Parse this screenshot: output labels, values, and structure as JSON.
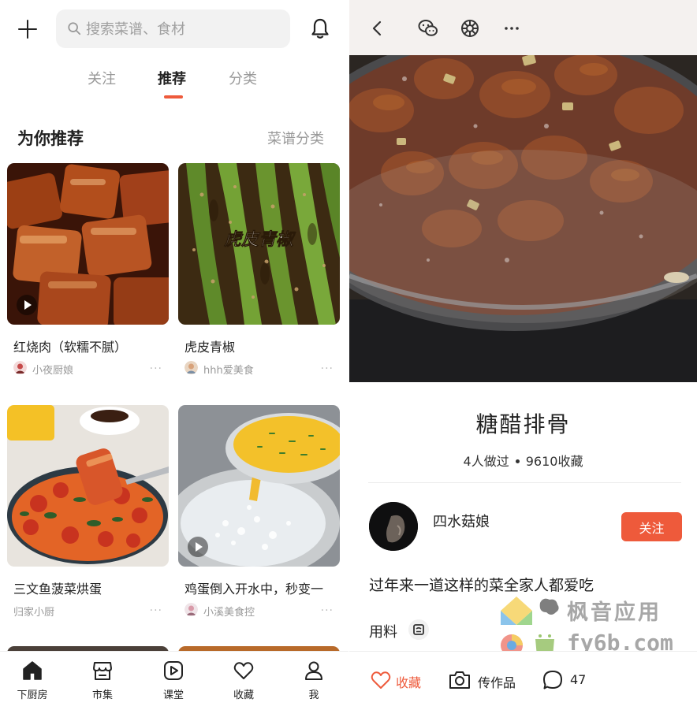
{
  "left": {
    "search": {
      "placeholder": "搜索菜谱、食材"
    },
    "tabs": [
      {
        "label": "关注",
        "active": false
      },
      {
        "label": "推荐",
        "active": true
      },
      {
        "label": "分类",
        "active": false
      }
    ],
    "section": {
      "title": "为你推荐",
      "link": "菜谱分类"
    },
    "cards": [
      {
        "title": "红烧肉（软糯不腻）",
        "author": "小夜厨娘",
        "more": "···",
        "has_video": true
      },
      {
        "title": "虎皮青椒",
        "author": "hhh爱美食",
        "more": "···",
        "has_video": false,
        "overlay_text": "虎皮青椒"
      },
      {
        "title": "三文鱼菠菜烘蛋",
        "author": "归家小厨",
        "more": "···",
        "has_video": false
      },
      {
        "title": "鸡蛋倒入开水中，秒变一",
        "author": "小溪美食控",
        "more": "···",
        "has_video": true
      }
    ],
    "nav": [
      {
        "label": "下厨房",
        "icon": "home-icon",
        "active": true
      },
      {
        "label": "市集",
        "icon": "shop-icon",
        "active": false
      },
      {
        "label": "课堂",
        "icon": "play-square-icon",
        "active": false
      },
      {
        "label": "收藏",
        "icon": "heart-icon",
        "active": false
      },
      {
        "label": "我",
        "icon": "person-icon",
        "active": false
      }
    ]
  },
  "right": {
    "recipe": {
      "title": "糖醋排骨",
      "made_count": "4人做过",
      "fav_count": "9610收藏"
    },
    "author": {
      "name": "四水菇娘",
      "follow_label": "关注"
    },
    "description": "过年来一道这样的菜全家人都爱吃",
    "ingredients_label": "用料",
    "actions": {
      "favorite_label": "收藏",
      "upload_label": "传作品",
      "comment_count": "47"
    },
    "watermark": {
      "line1": "枫音应用",
      "line2": "fy6b.com"
    }
  },
  "colors": {
    "accent": "#ee5a3b",
    "muted": "#999999"
  }
}
